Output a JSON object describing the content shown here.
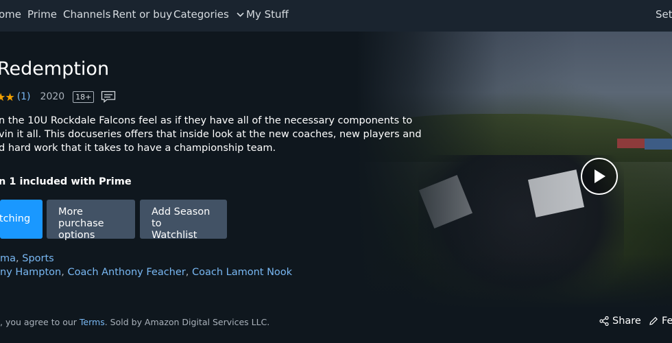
{
  "nav": {
    "home": "ome",
    "prime": "Prime",
    "channels": "Channels",
    "rent_or_buy": "Rent or buy",
    "categories": "Categories",
    "my_stuff": "My Stuff",
    "settings": "Setti"
  },
  "title": {
    "text": "Redemption",
    "rating_count": "(1)",
    "year": "2020",
    "maturity_rating": "18+"
  },
  "synopsis": {
    "line1": "n the 10U Rockdale Falcons feel as if they have all of the necessary components to",
    "line2": "vin it all. This docuseries offers that inside look at the new coaches, new players and",
    "line3": "d hard work that it takes to have a championship team."
  },
  "season_info": "n 1 included with Prime",
  "buttons": {
    "watch": "atching",
    "purchase_line1": "More purchase",
    "purchase_line2": "options",
    "watchlist_line1": "Add Season to",
    "watchlist_line2": "Watchlist"
  },
  "genres": {
    "items": [
      "ma",
      "Sports"
    ]
  },
  "cast": {
    "items": [
      "ny Hampton",
      "Coach Anthony Feacher",
      "Coach Lamont Nook"
    ]
  },
  "legal": {
    "prefix": ", you agree to our ",
    "terms": "Terms",
    "suffix": ". Sold by Amazon Digital Services LLC."
  },
  "actions": {
    "share": "Share",
    "feedback": "Fe"
  },
  "icons": {
    "categories_caret": "chevron-down-icon",
    "subtitles": "subtitles-icon",
    "play": "play-icon",
    "share": "share-icon",
    "feedback": "pencil-icon"
  },
  "colors": {
    "background": "#0f171e",
    "navbar": "#1a242f",
    "primary_button": "#1a98ff",
    "secondary_button": "#425265",
    "link": "#79b8f3",
    "star": "#f2a000"
  }
}
